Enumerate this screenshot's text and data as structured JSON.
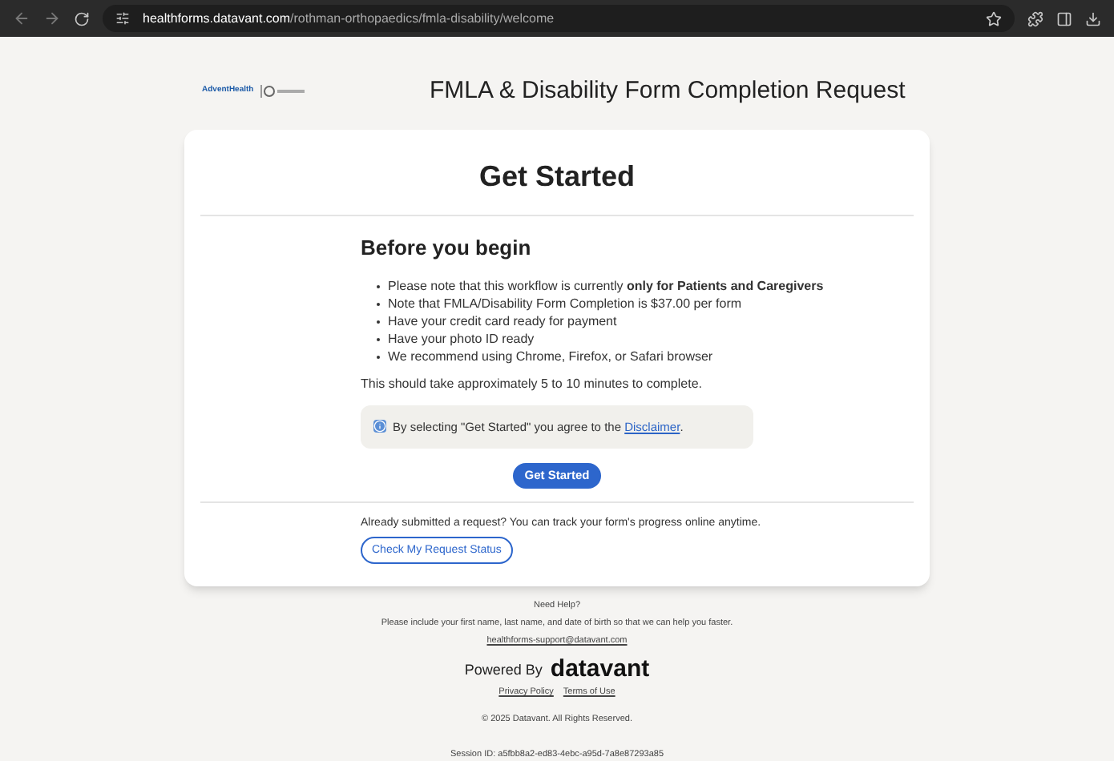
{
  "browser": {
    "url_host": "healthforms.datavant.com",
    "url_path": "/rothman-orthopaedics/fmla-disability/welcome"
  },
  "header": {
    "logo_text": "AdventHealth",
    "title": "FMLA & Disability Form Completion Request"
  },
  "card": {
    "title": "Get Started",
    "section_title": "Before you begin",
    "bullets": [
      "Please note that this workflow is currently **only for Patients and Caregivers**",
      "Note that FMLA/Disability Form Completion is $37.00 per form",
      "Have your credit card ready for payment",
      "Have your photo ID ready",
      "We recommend using Chrome, Firefox, or Safari browser"
    ],
    "duration": "This should take approximately 5 to 10 minutes to complete.",
    "notice": {
      "text": "By selecting \"Get Started\" you agree to the",
      "link": "Disclaimer",
      "end": "."
    },
    "primary_button": "Get Started",
    "track_text": "Already submitted a request? You can track your form's progress online anytime.",
    "status_button": "Check My Request Status"
  },
  "footer": {
    "help_title": "Need Help?",
    "help_text": "Please include your first name, last name, and date of birth so that we can help you faster.",
    "email": "healthforms-support@datavant.com",
    "powered_by": "Powered By",
    "brand": "datavant",
    "links": [
      "Privacy Policy",
      "Terms of Use"
    ],
    "copyright": "© 2025 Datavant. All Rights Reserved.",
    "session": "Session ID: a5fbb8a2-ed83-4ebc-a95d-7a8e87293a85"
  }
}
